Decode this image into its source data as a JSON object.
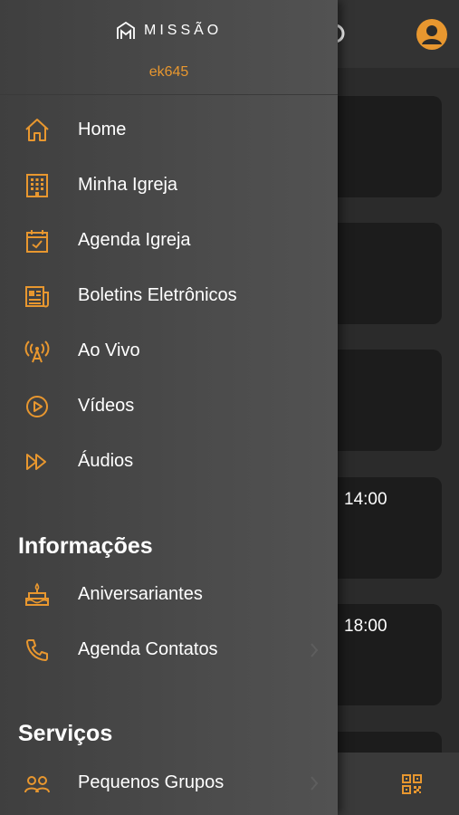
{
  "drawer": {
    "logo_text": "MISSÃO",
    "user_code": "ek645",
    "main_items": [
      {
        "label": "Home",
        "icon": "home-icon"
      },
      {
        "label": "Minha Igreja",
        "icon": "building-icon"
      },
      {
        "label": "Agenda Igreja",
        "icon": "calendar-check-icon"
      },
      {
        "label": "Boletins Eletrônicos",
        "icon": "newspaper-icon"
      },
      {
        "label": "Ao Vivo",
        "icon": "broadcast-icon"
      },
      {
        "label": "Vídeos",
        "icon": "play-circle-icon"
      },
      {
        "label": "Áudios",
        "icon": "fast-forward-icon"
      }
    ],
    "sections": [
      {
        "title": "Informações",
        "items": [
          {
            "label": "Aniversariantes",
            "icon": "cake-icon"
          },
          {
            "label": "Agenda Contatos",
            "icon": "phone-icon"
          }
        ]
      },
      {
        "title": "Serviços",
        "items": [
          {
            "label": "Pequenos Grupos",
            "icon": "people-icon"
          }
        ]
      }
    ]
  },
  "background": {
    "cards": [
      {
        "time": ""
      },
      {
        "time": ""
      },
      {
        "time": ""
      },
      {
        "time": "14:00"
      },
      {
        "time": "18:00"
      },
      {
        "time": ""
      }
    ]
  },
  "colors": {
    "accent": "#e8972f",
    "drawer_bg": "#4a4a4a",
    "card_bg": "#1c1c1c",
    "text": "#ffffff"
  }
}
